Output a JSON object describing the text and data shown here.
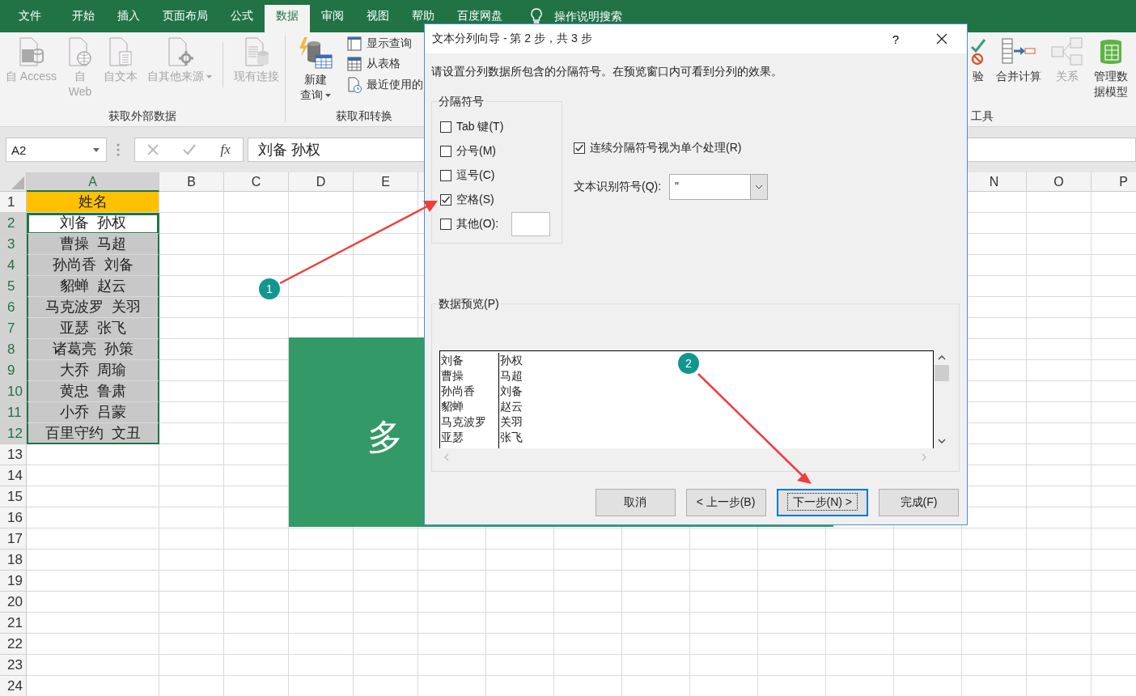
{
  "tabs": [
    {
      "label": "文件",
      "selected": false
    },
    {
      "label": "开始",
      "selected": false
    },
    {
      "label": "插入",
      "selected": false
    },
    {
      "label": "页面布局",
      "selected": false
    },
    {
      "label": "公式",
      "selected": false
    },
    {
      "label": "数据",
      "selected": true
    },
    {
      "label": "审阅",
      "selected": false
    },
    {
      "label": "视图",
      "selected": false
    },
    {
      "label": "帮助",
      "selected": false
    },
    {
      "label": "百度网盘",
      "selected": false
    }
  ],
  "tell_me": "操作说明搜索",
  "ribbon": {
    "groups": [
      {
        "label": "获取外部数据",
        "buttons": [
          {
            "kind": "access",
            "label": "自 Access",
            "disabled": true,
            "dropdown": false
          },
          {
            "kind": "web",
            "label": "自 Web",
            "disabled": true,
            "dropdown": false
          },
          {
            "kind": "text",
            "label": "自文本",
            "disabled": true,
            "dropdown": false
          },
          {
            "kind": "other",
            "label": "自其他来源",
            "disabled": true,
            "dropdown": true
          },
          {
            "kind": "connection",
            "label": "现有连接",
            "disabled": true,
            "dropdown": false
          }
        ]
      },
      {
        "label": "获取和转换",
        "buttons": [
          {
            "kind": "query",
            "label": "新建查询",
            "disabled": false,
            "dropdown": true
          }
        ],
        "small_buttons": [
          {
            "kind": "show",
            "label": "显示查询"
          },
          {
            "kind": "table",
            "label": "从表格"
          },
          {
            "kind": "recent",
            "label": "最近使用的"
          }
        ]
      }
    ],
    "right_group": {
      "label": "工具",
      "buttons": [
        {
          "kind": "validation",
          "label": "验",
          "disabled": false,
          "dropdown": false
        },
        {
          "kind": "consolidate",
          "label": "合并计算",
          "disabled": false,
          "dropdown": false
        },
        {
          "kind": "relation",
          "label": "关系",
          "disabled": true,
          "dropdown": false
        },
        {
          "kind": "model",
          "label": "管理数据模型",
          "disabled": false,
          "dropdown": false
        }
      ]
    }
  },
  "formula_bar": {
    "name_box": "A2",
    "fx": "fx",
    "formula": "刘备 孙权"
  },
  "grid": {
    "columns": [
      {
        "label": "A",
        "selected": true
      },
      {
        "label": "B",
        "selected": false
      },
      {
        "label": "C",
        "selected": false
      },
      {
        "label": "D",
        "selected": false
      },
      {
        "label": "E",
        "selected": false
      },
      {
        "label": "N",
        "selected": false
      },
      {
        "label": "O",
        "selected": false
      },
      {
        "label": "P",
        "selected": false
      }
    ],
    "rows": [
      {
        "number": "1",
        "value": "姓名",
        "kind": "header",
        "selected": false,
        "active": false
      },
      {
        "number": "2",
        "value": "刘备  孙权",
        "kind": "data",
        "selected": true,
        "active": true
      },
      {
        "number": "3",
        "value": "曹操  马超",
        "kind": "data",
        "selected": true,
        "active": false
      },
      {
        "number": "4",
        "value": "孙尚香  刘备",
        "kind": "data",
        "selected": true,
        "active": false
      },
      {
        "number": "5",
        "value": "貂蝉  赵云",
        "kind": "data",
        "selected": true,
        "active": false
      },
      {
        "number": "6",
        "value": "马克波罗  关羽",
        "kind": "data",
        "selected": true,
        "active": false
      },
      {
        "number": "7",
        "value": "亚瑟  张飞",
        "kind": "data",
        "selected": true,
        "active": false
      },
      {
        "number": "8",
        "value": "诸葛亮  孙策",
        "kind": "data",
        "selected": true,
        "active": false
      },
      {
        "number": "9",
        "value": "大乔  周瑜",
        "kind": "data",
        "selected": true,
        "active": false
      },
      {
        "number": "10",
        "value": "黄忠  鲁肃",
        "kind": "data",
        "selected": true,
        "active": false
      },
      {
        "number": "11",
        "value": "小乔  吕蒙",
        "kind": "data",
        "selected": true,
        "active": false
      },
      {
        "number": "12",
        "value": "百里守约  文丑",
        "kind": "data",
        "selected": true,
        "active": false
      },
      {
        "number": "13",
        "kind": "data",
        "selected": false,
        "active": false
      },
      {
        "number": "14",
        "kind": "data",
        "selected": false,
        "active": false
      },
      {
        "number": "15",
        "kind": "data",
        "selected": false,
        "active": false
      },
      {
        "number": "16",
        "kind": "data",
        "selected": false,
        "active": false
      },
      {
        "number": "17",
        "kind": "data",
        "selected": false,
        "active": false
      },
      {
        "number": "18",
        "kind": "data",
        "selected": false,
        "active": false
      },
      {
        "number": "19",
        "kind": "data",
        "selected": false,
        "active": false
      },
      {
        "number": "20",
        "kind": "data",
        "selected": false,
        "active": false
      },
      {
        "number": "21",
        "kind": "data",
        "selected": false,
        "active": false
      },
      {
        "number": "22",
        "kind": "data",
        "selected": false,
        "active": false
      },
      {
        "number": "23",
        "kind": "data",
        "selected": false,
        "active": false
      },
      {
        "number": "24",
        "kind": "data",
        "selected": false,
        "active": false
      }
    ]
  },
  "banner": {
    "text": "多"
  },
  "dialog": {
    "title": "文本分列向导 - 第 2 步，共 3 步",
    "help": "?",
    "instruction": "请设置分列数据所包含的分隔符号。在预览窗口内可看到分列的效果。",
    "delimiters": {
      "title": "分隔符号",
      "options": [
        {
          "kind": "plain",
          "label": "Tab 键(T)",
          "checked": false
        },
        {
          "kind": "plain",
          "label": "分号(M)",
          "checked": false
        },
        {
          "kind": "plain",
          "label": "逗号(C)",
          "checked": false
        },
        {
          "kind": "plain",
          "label": "空格(S)",
          "checked": true
        },
        {
          "kind": "with_field",
          "label": "其他(O):",
          "checked": false
        }
      ]
    },
    "consecutive": {
      "label": "连续分隔符号视为单个处理(R)",
      "checked": true
    },
    "qualifier": {
      "label": "文本识别符号(Q):",
      "value": "\""
    },
    "preview": {
      "title": "数据预览(P)",
      "rows": [
        {
          "col_1": "刘备",
          "col_2": "孙权"
        },
        {
          "col_1": "曹操",
          "col_2": "马超"
        },
        {
          "col_1": "孙尚香",
          "col_2": "刘备"
        },
        {
          "col_1": "貂蝉",
          "col_2": "赵云"
        },
        {
          "col_1": "马克波罗",
          "col_2": "关羽"
        },
        {
          "col_1": "亚瑟",
          "col_2": "张飞"
        }
      ]
    },
    "buttons": [
      {
        "label": "取消",
        "focused": false
      },
      {
        "label": "< 上一步(B)",
        "focused": false
      },
      {
        "label": "下一步(N) >",
        "focused": true
      },
      {
        "label": "完成(F)",
        "focused": false
      }
    ]
  },
  "annotations": [
    {
      "label": "1"
    },
    {
      "label": "2"
    }
  ]
}
